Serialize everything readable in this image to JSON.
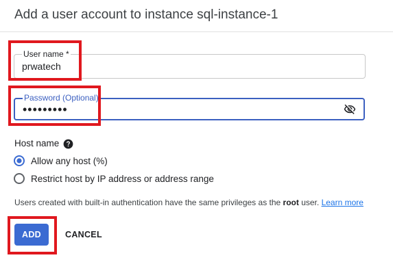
{
  "dialog": {
    "title": "Add a user account to instance sql-instance-1"
  },
  "username": {
    "label": "User name *",
    "value": "prwatech"
  },
  "password": {
    "label": "Password (Optional)",
    "value": "•••••••••",
    "toggle_icon": "visibility-off-icon"
  },
  "host": {
    "title": "Host name",
    "help_icon": "help-circle-icon",
    "options": [
      {
        "label": "Allow any host (%)",
        "selected": true
      },
      {
        "label": "Restrict host by IP address or address range",
        "selected": false
      }
    ]
  },
  "info": {
    "text_before": "Users created with built-in authentication have the same privileges as the ",
    "bold": "root",
    "text_after": " user. ",
    "link": "Learn more"
  },
  "actions": {
    "add_label": "ADD",
    "cancel_label": "CANCEL"
  },
  "colors": {
    "primary": "#3b6bd2",
    "focus": "#3b5fc0",
    "highlight": "#e0181e",
    "link": "#1a73e8"
  }
}
